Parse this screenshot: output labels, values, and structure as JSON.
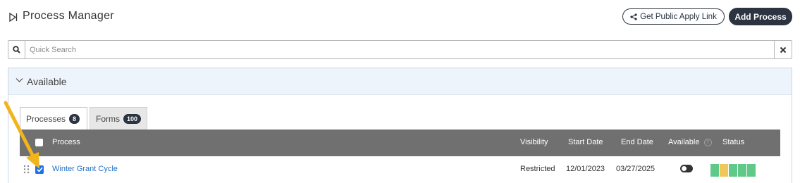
{
  "header": {
    "title": "Process Manager",
    "public_link_label": "Get Public Apply Link",
    "add_process_label": "Add Process"
  },
  "search": {
    "placeholder": "Quick Search"
  },
  "panel": {
    "title": "Available"
  },
  "tabs": [
    {
      "label": "Processes",
      "count": "8"
    },
    {
      "label": "Forms",
      "count": "100"
    }
  ],
  "table": {
    "columns": {
      "process": "Process",
      "visibility": "Visibility",
      "start_date": "Start Date",
      "end_date": "End Date",
      "available": "Available",
      "status": "Status"
    },
    "rows": [
      {
        "process": "Winter Grant Cycle",
        "visibility": "Restricted",
        "start_date": "12/01/2023",
        "end_date": "03/27/2025",
        "checked": true,
        "available": true,
        "status_colors": [
          "#5fc98a",
          "#f0c85a",
          "#5fc98a",
          "#5fc98a",
          "#5fc98a"
        ]
      }
    ]
  },
  "colors": {
    "accent_dark": "#2b3440",
    "link": "#2372c5",
    "table_header": "#707070",
    "arrow": "#f2b41c"
  },
  "icons": {
    "title": "play-outline-icon",
    "share": "share-icon",
    "search": "search-icon",
    "clear": "close-icon",
    "collapse": "chevron-down-icon",
    "drag": "drag-handle-icon",
    "help": "question-circle-icon"
  }
}
